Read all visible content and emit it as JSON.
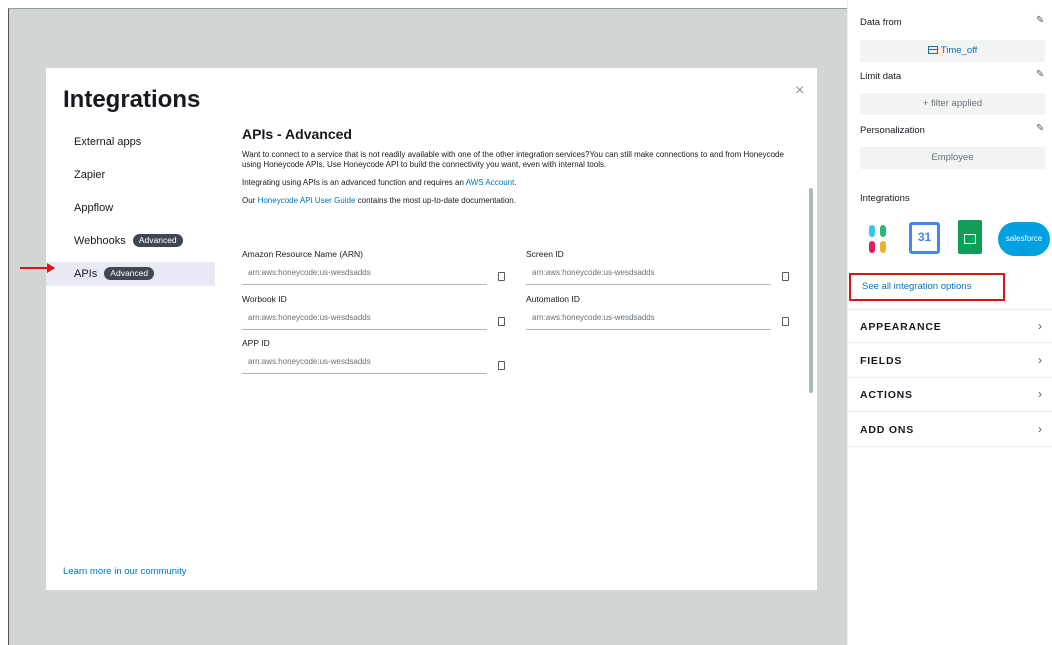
{
  "modal": {
    "title": "Integrations",
    "close_icon": "×",
    "nav": [
      {
        "label": "External apps"
      },
      {
        "label": "Zapier"
      },
      {
        "label": "Appflow"
      },
      {
        "label": "Webhooks",
        "badge": "Advanced"
      },
      {
        "label": "APIs",
        "badge": "Advanced",
        "active": true
      }
    ],
    "content": {
      "title": "APIs - Advanced",
      "para1": "Want to connect to a service that is not readily available with one of the other integration services?You can still make connections to and from Honeycode using Honeycode APIs. Use Honeycode API to build the connectivity you want, even with internal tools.",
      "para2_prefix": "Integrating using APIs is an advanced function and requires an ",
      "para2_link": "AWS Account",
      "para2_suffix": ".",
      "para3_prefix": "Our ",
      "para3_link": "Honeycode API User Guide",
      "para3_suffix": " contains the most up-to-date documentation.",
      "fields": [
        {
          "label": "Amazon Resource Name (ARN)",
          "placeholder": "arn:aws:honeycode:us-wesdsadds"
        },
        {
          "label": "Screen ID",
          "placeholder": "arn:aws:honeycode:us-wesdsadds"
        },
        {
          "label": "Worbook ID",
          "placeholder": "arn:aws:honeycode:us-wesdsadds"
        },
        {
          "label": "Automation ID",
          "placeholder": "arn:aws:honeycode:us-wesdsadds"
        },
        {
          "label": "APP ID",
          "placeholder": "arn:aws:honeycode:us-wesdsadds"
        }
      ]
    },
    "community_link": "Learn more in our community"
  },
  "panel": {
    "data_from_label": "Data from",
    "data_from_value": "Time_off",
    "limit_label": "Limit data",
    "limit_value": "+ filter applied",
    "personalization_label": "Personalization",
    "personalization_value": "Employee",
    "integrations_label": "Integrations",
    "calendar_day": "31",
    "salesforce_label": "salesforce",
    "see_all": "See all integration options",
    "sections": [
      "APPEARANCE",
      "FIELDS",
      "ACTIONS",
      "ADD ONS"
    ],
    "edit_icon": "✎"
  },
  "colors": {
    "accent": "#0073bb",
    "highlight": "#d91515",
    "badge_bg": "#414750",
    "active_nav_bg": "#e8e9f4"
  },
  "icons": [
    "close-icon",
    "copy-icon",
    "pencil-icon",
    "table-icon",
    "slack-icon",
    "google-calendar-icon",
    "google-sheets-icon",
    "salesforce-icon",
    "chevron-right-icon"
  ]
}
